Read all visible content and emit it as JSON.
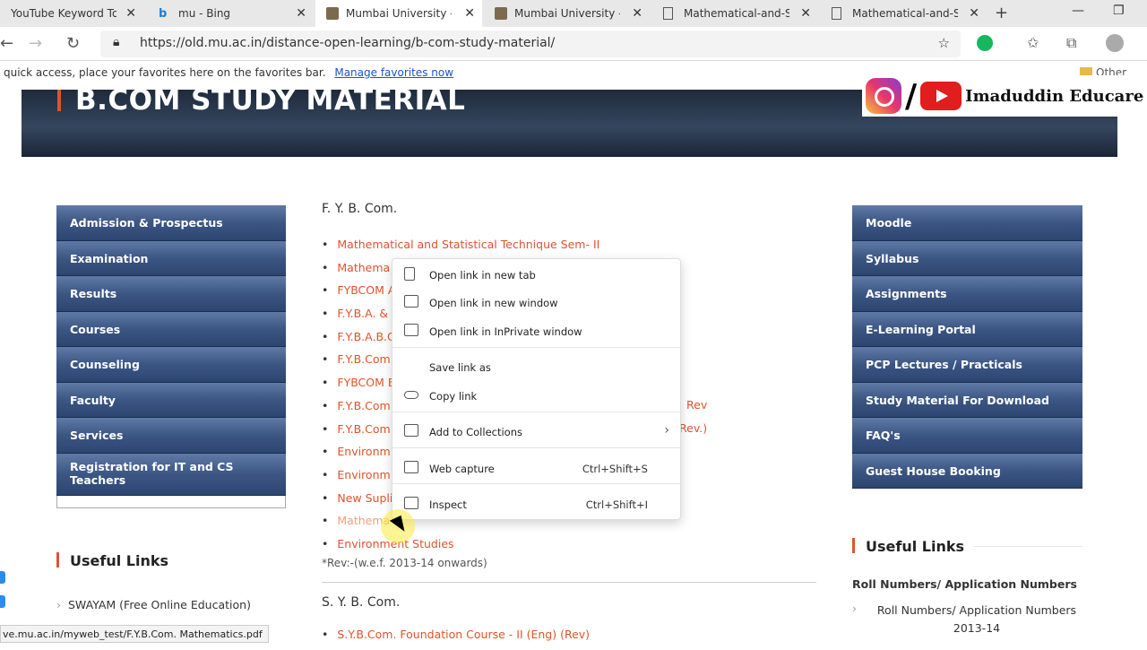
{
  "browser": {
    "tabs": [
      {
        "title": "YouTube Keyword Tool",
        "active": false
      },
      {
        "title": "mu - Bing",
        "active": false
      },
      {
        "title": "Mumbai University – En",
        "active": true
      },
      {
        "title": "Mumbai University – En",
        "active": false
      },
      {
        "title": "Mathematical-and-Stat",
        "active": false
      },
      {
        "title": "Mathematical-and-Stat",
        "active": false
      }
    ],
    "url": "https://old.mu.ac.in/distance-open-learning/b-com-study-material/",
    "favorites_text": "quick access, place your favorites here on the favorites bar.",
    "favorites_link": "Manage favorites now",
    "other_favorites": "Other favo"
  },
  "brand": {
    "name": "Imaduddin Educare"
  },
  "page": {
    "title": "B.COM STUDY MATERIAL",
    "left_nav": [
      "Admission & Prospectus",
      "Examination",
      "Results",
      "Courses",
      "Counseling",
      "Faculty",
      "Services",
      "Registration for IT and CS Teachers"
    ],
    "right_nav": [
      "Moodle",
      "Syllabus",
      "Assignments",
      "E-Learning Portal",
      "PCP Lectures / Practicals",
      "Study Material For Download",
      "FAQ's",
      "Guest House Booking"
    ],
    "fy_heading": "F. Y. B. Com.",
    "fy_items": [
      "Mathematical and Statistical Technique Sem- II",
      "Mathema",
      "FYBCOM A",
      "F.Y.B.A. &",
      "F.Y.B.A.B.C",
      "F.Y.B.Com",
      "FYBCOM E",
      "F.Y.B.Com",
      "F.Y.B.Com",
      "Environm",
      "Environm",
      "New Supli",
      "Mathema",
      "Environment Studies"
    ],
    "fy_partial_right": {
      "item7": "Rev",
      "item8": "Rev.)"
    },
    "note": "*Rev:-(w.e.f. 2013-14 onwards)",
    "sy_heading": "S. Y. B. Com.",
    "sy_items": [
      "S.Y.B.Com. Foundation Course - II (Eng) (Rev)"
    ],
    "useful_links_left": {
      "heading": "Useful Links",
      "items": [
        "SWAYAM (Free Online Education)"
      ]
    },
    "useful_links_right": {
      "heading": "Useful Links",
      "sub": "Roll Numbers/ Application Numbers",
      "items": [
        "Roll Numbers/ Application Numbers 2013-14"
      ]
    }
  },
  "context_menu": [
    {
      "label": "Open link in new tab",
      "icon": "new-tab-icon",
      "shortcut": ""
    },
    {
      "label": "Open link in new window",
      "icon": "new-window-icon",
      "shortcut": ""
    },
    {
      "label": "Open link in InPrivate window",
      "icon": "inprivate-icon",
      "shortcut": ""
    },
    {
      "label": "Save link as",
      "icon": "",
      "shortcut": ""
    },
    {
      "label": "Copy link",
      "icon": "copy-link-icon",
      "shortcut": ""
    },
    {
      "label": "Add to Collections",
      "icon": "collections-icon",
      "shortcut": ""
    },
    {
      "label": "Web capture",
      "icon": "web-capture-icon",
      "shortcut": "Ctrl+Shift+S"
    },
    {
      "label": "Inspect",
      "icon": "inspect-icon",
      "shortcut": "Ctrl+Shift+I"
    }
  ],
  "status_bar": "ve.mu.ac.in/myweb_test/F.Y.B.Com. Mathematics.pdf",
  "colors": {
    "accent": "#e0532c",
    "nav_blue": "#3c5684",
    "link_blue": "#1a55c8"
  }
}
